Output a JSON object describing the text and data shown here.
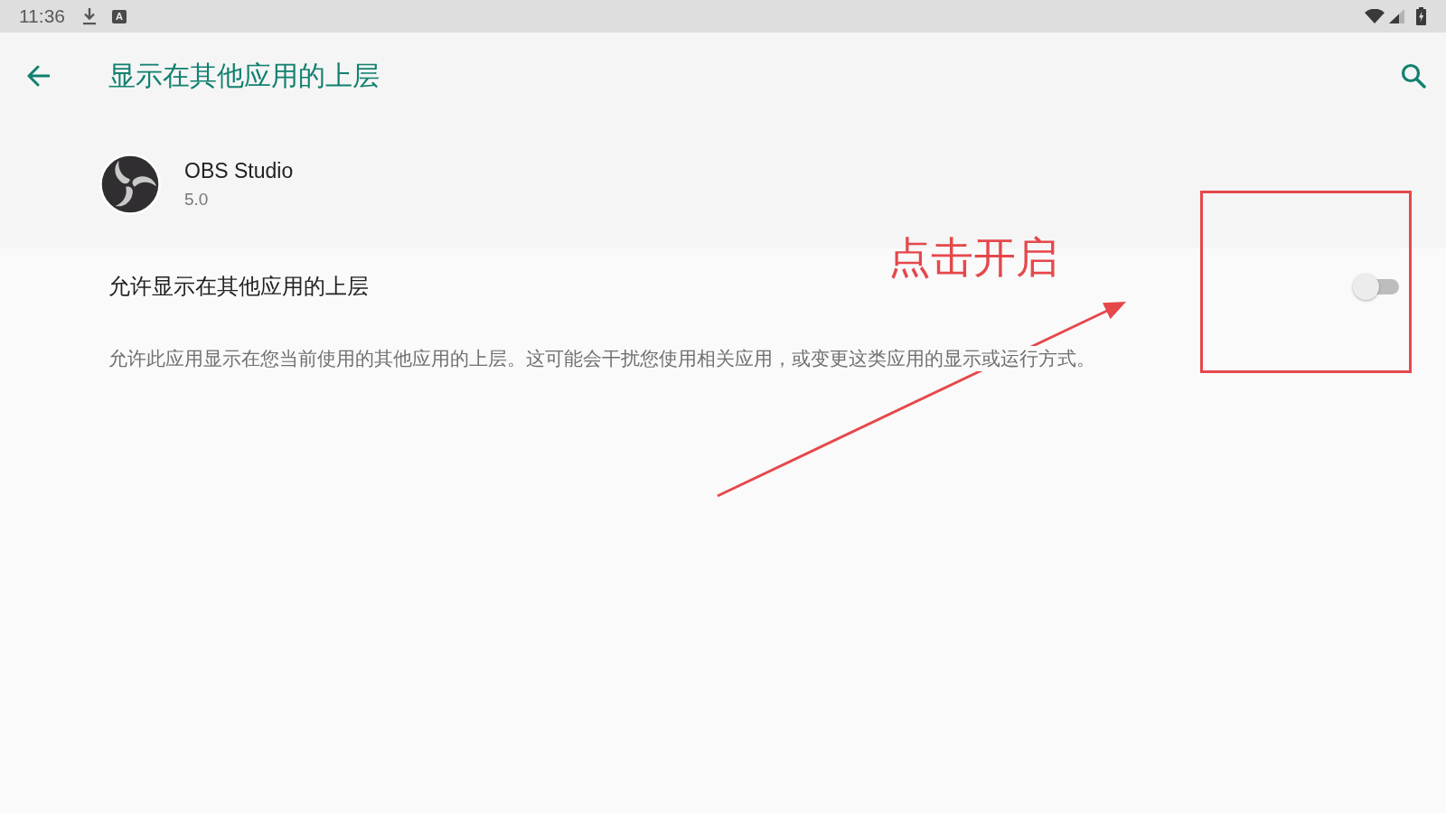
{
  "status_bar": {
    "time": "11:36",
    "input_indicator": "A"
  },
  "app_bar": {
    "title": "显示在其他应用的上层"
  },
  "app": {
    "name": "OBS Studio",
    "version": "5.0"
  },
  "setting": {
    "title": "允许显示在其他应用的上层",
    "on": false,
    "description": "允许此应用显示在您当前使用的其他应用的上层。这可能会干扰您使用相关应用，或变更这类应用的显示或运行方式。"
  },
  "annotation": {
    "label": "点击开启"
  }
}
